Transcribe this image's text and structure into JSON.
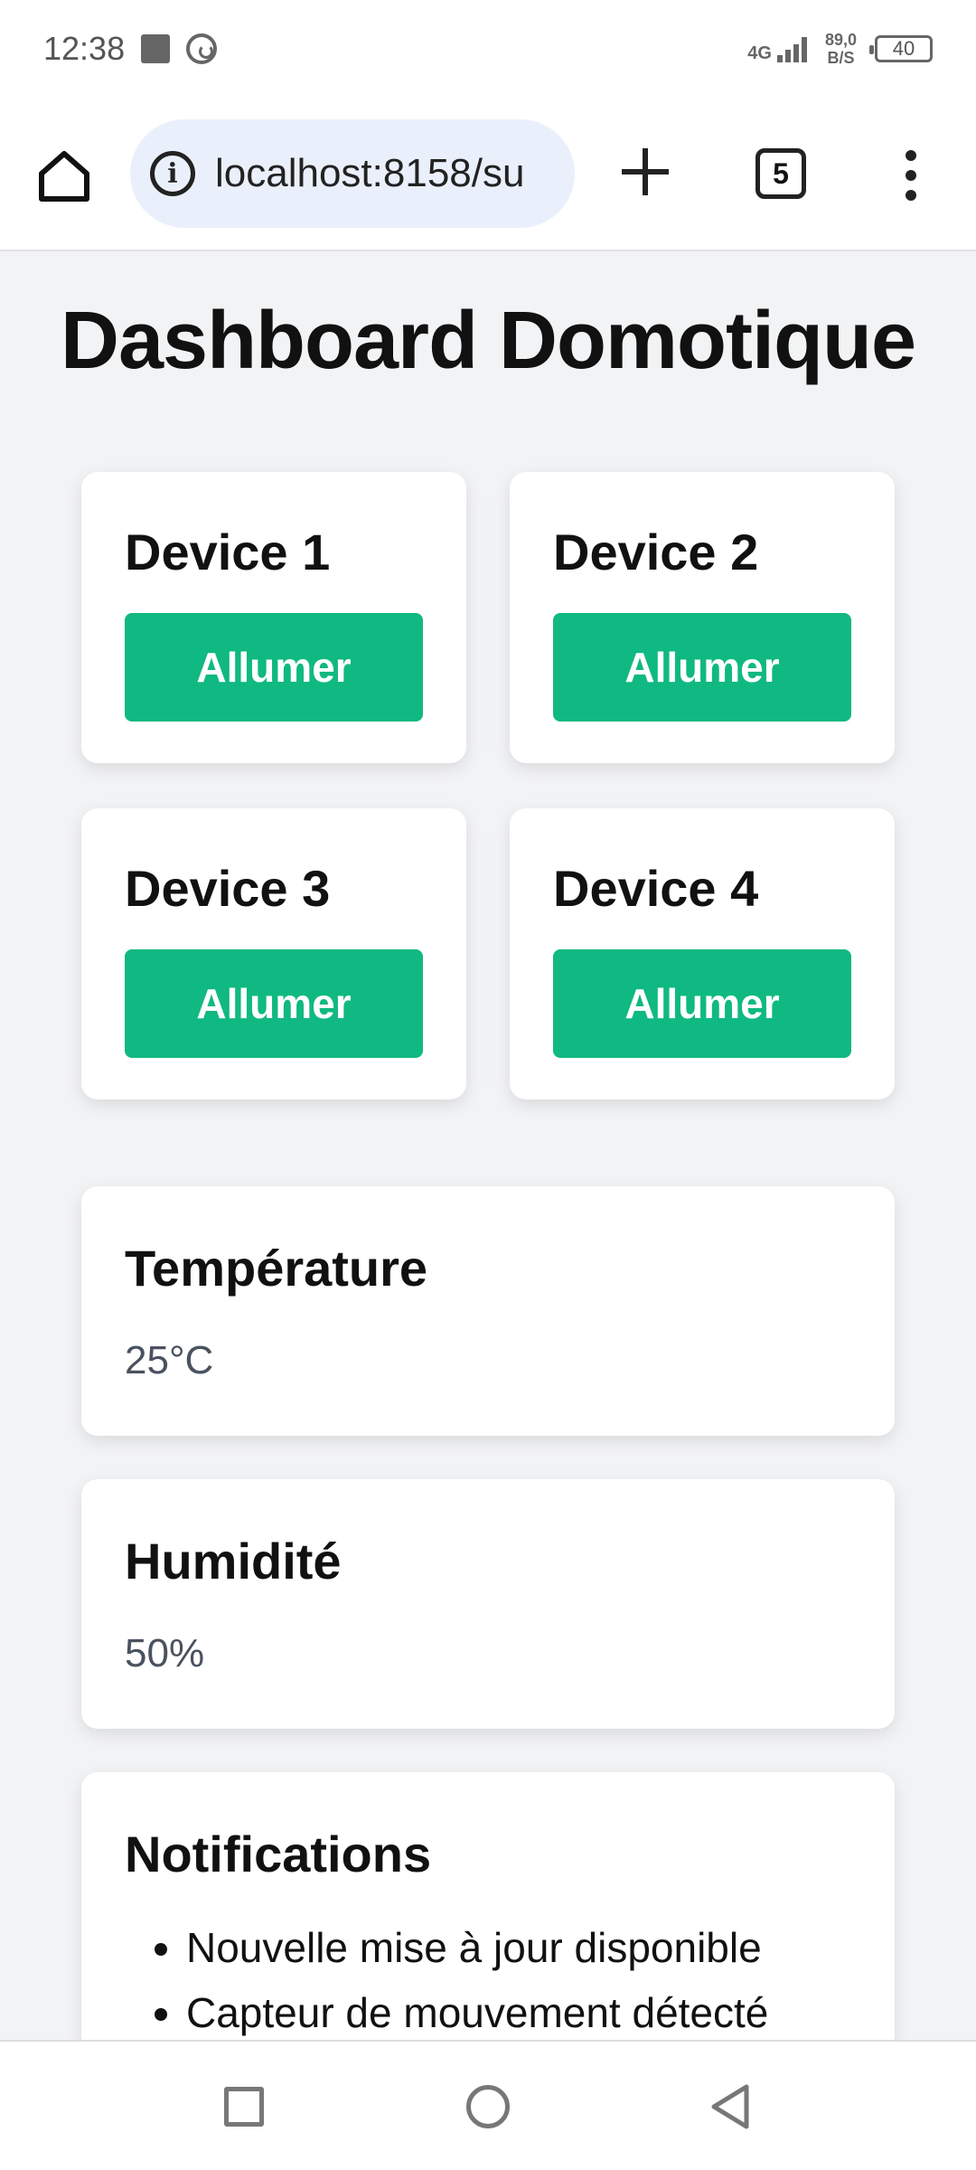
{
  "status_bar": {
    "time": "12:38",
    "network": "4G",
    "speed_top": "89,0",
    "speed_bottom": "B/S",
    "battery": "40"
  },
  "browser": {
    "url": "localhost:8158/su",
    "tab_count": "5"
  },
  "page": {
    "title": "Dashboard Domotique",
    "devices": [
      {
        "name": "Device 1",
        "button": "Allumer"
      },
      {
        "name": "Device 2",
        "button": "Allumer"
      },
      {
        "name": "Device 3",
        "button": "Allumer"
      },
      {
        "name": "Device 4",
        "button": "Allumer"
      }
    ],
    "temperature": {
      "title": "Température",
      "value": "25°C"
    },
    "humidity": {
      "title": "Humidité",
      "value": "50%"
    },
    "notifications": {
      "title": "Notifications",
      "items": [
        "Nouvelle mise à jour disponible",
        "Capteur de mouvement détecté"
      ]
    }
  },
  "colors": {
    "accent": "#10b981",
    "background": "#f2f3f5"
  }
}
